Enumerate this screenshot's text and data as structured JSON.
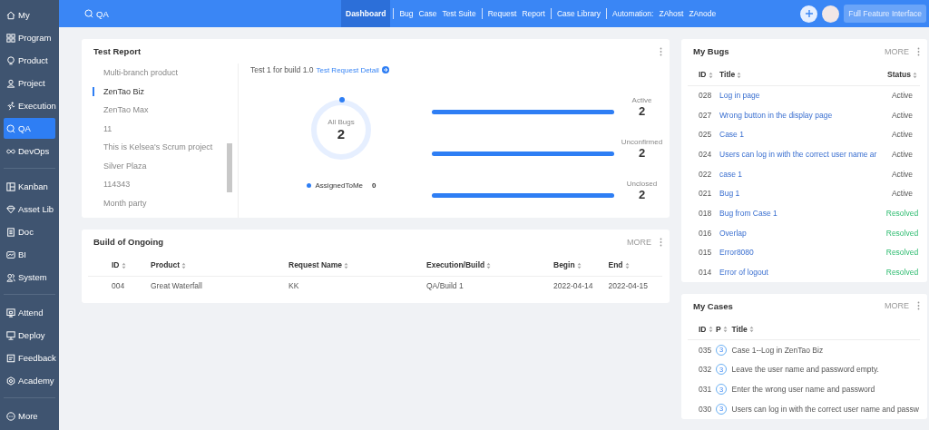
{
  "sidebar": {
    "groups": [
      [
        {
          "label": "My",
          "selected": false
        },
        {
          "label": "Program",
          "selected": false
        },
        {
          "label": "Product",
          "selected": false
        },
        {
          "label": "Project",
          "selected": false
        },
        {
          "label": "Execution",
          "selected": false
        },
        {
          "label": "QA",
          "selected": true
        },
        {
          "label": "DevOps",
          "selected": false
        }
      ],
      [
        {
          "label": "Kanban",
          "selected": false
        },
        {
          "label": "Asset Lib",
          "selected": false
        },
        {
          "label": "Doc",
          "selected": false
        },
        {
          "label": "BI",
          "selected": false
        },
        {
          "label": "System",
          "selected": false
        }
      ],
      [
        {
          "label": "Attend",
          "selected": false
        },
        {
          "label": "Deploy",
          "selected": false
        },
        {
          "label": "Feedback",
          "selected": false
        },
        {
          "label": "Academy",
          "selected": false
        }
      ],
      [
        {
          "label": "More",
          "selected": false
        }
      ]
    ]
  },
  "topbar": {
    "module": "QA",
    "nav_groups": [
      [
        {
          "kind": "link",
          "label": "Dashboard",
          "selected": true
        }
      ],
      [
        {
          "kind": "link",
          "label": "Bug",
          "selected": false
        },
        {
          "kind": "link",
          "label": "Case",
          "selected": false
        },
        {
          "kind": "link",
          "label": "Test Suite",
          "selected": false
        }
      ],
      [
        {
          "kind": "link",
          "label": "Request",
          "selected": false
        },
        {
          "kind": "link",
          "label": "Report",
          "selected": false
        }
      ],
      [
        {
          "kind": "link",
          "label": "Case Library",
          "selected": false
        }
      ],
      [
        {
          "kind": "label",
          "label": "Automation:"
        },
        {
          "kind": "link",
          "label": "ZAhost",
          "selected": false
        },
        {
          "kind": "link",
          "label": "ZAnode",
          "selected": false
        }
      ]
    ],
    "full_feature_button": "Full Feature Interface"
  },
  "test_report": {
    "title": "Test Report",
    "products": [
      {
        "label": "Multi-branch product",
        "selected": false
      },
      {
        "label": "ZenTao Biz",
        "selected": true
      },
      {
        "label": "ZenTao Max",
        "selected": false
      },
      {
        "label": "11",
        "selected": false
      },
      {
        "label": "This is Kelsea's Scrum project",
        "selected": false
      },
      {
        "label": "Silver Plaza",
        "selected": false
      },
      {
        "label": "114343",
        "selected": false
      },
      {
        "label": "Month party",
        "selected": false
      }
    ],
    "summary": "Test 1 for build 1.0",
    "detail_link": "Test Request Detail",
    "all_bugs_label": "All Bugs",
    "all_bugs_count": "2",
    "legend_label": "AssignedToMe",
    "legend_count": "0",
    "stats": [
      {
        "label": "Active",
        "value": "2",
        "level": 1
      },
      {
        "label": "Unconfirmed",
        "value": "2",
        "level": 1
      },
      {
        "label": "Unclosed",
        "value": "2",
        "level": 1
      }
    ]
  },
  "build_of_ongoing": {
    "title": "Build of Ongoing",
    "more": "MORE",
    "columns": [
      "ID",
      "Product",
      "Request Name",
      "Execution/Build",
      "Begin",
      "End"
    ],
    "rows": [
      [
        "004",
        "Great Waterfall",
        "KK",
        "QA/Build 1",
        "2022-04-14",
        "2022-04-15"
      ]
    ]
  },
  "my_bugs": {
    "title": "My Bugs",
    "more": "MORE",
    "columns": [
      "ID",
      "Title",
      "Status"
    ],
    "rows": [
      {
        "id": "028",
        "title": "Log in page",
        "status": "Active",
        "kind": "active"
      },
      {
        "id": "027",
        "title": "Wrong button in the display page",
        "status": "Active",
        "kind": "active"
      },
      {
        "id": "025",
        "title": "Case 1",
        "status": "Active",
        "kind": "active"
      },
      {
        "id": "024",
        "title": "Users can log in with the correct user name ar",
        "status": "Active",
        "kind": "active"
      },
      {
        "id": "022",
        "title": "case 1",
        "status": "Active",
        "kind": "active"
      },
      {
        "id": "021",
        "title": "Bug 1",
        "status": "Active",
        "kind": "active"
      },
      {
        "id": "018",
        "title": "Bug from Case 1",
        "status": "Resolved",
        "kind": "resolved"
      },
      {
        "id": "016",
        "title": "Overlap",
        "status": "Resolved",
        "kind": "resolved"
      },
      {
        "id": "015",
        "title": "Error8080",
        "status": "Resolved",
        "kind": "resolved"
      },
      {
        "id": "014",
        "title": "Error of logout",
        "status": "Resolved",
        "kind": "resolved"
      }
    ]
  },
  "my_cases": {
    "title": "My Cases",
    "more": "MORE",
    "columns": [
      "ID",
      "P",
      "Title"
    ],
    "rows": [
      {
        "id": "035",
        "priority": "3",
        "title": "Case 1--Log in ZenTao Biz"
      },
      {
        "id": "032",
        "priority": "3",
        "title": "Leave the user name and password empty."
      },
      {
        "id": "031",
        "priority": "3",
        "title": "Enter the wrong user name and password"
      },
      {
        "id": "030",
        "priority": "3",
        "title": "Users can log in with the correct user name and passw"
      }
    ]
  }
}
